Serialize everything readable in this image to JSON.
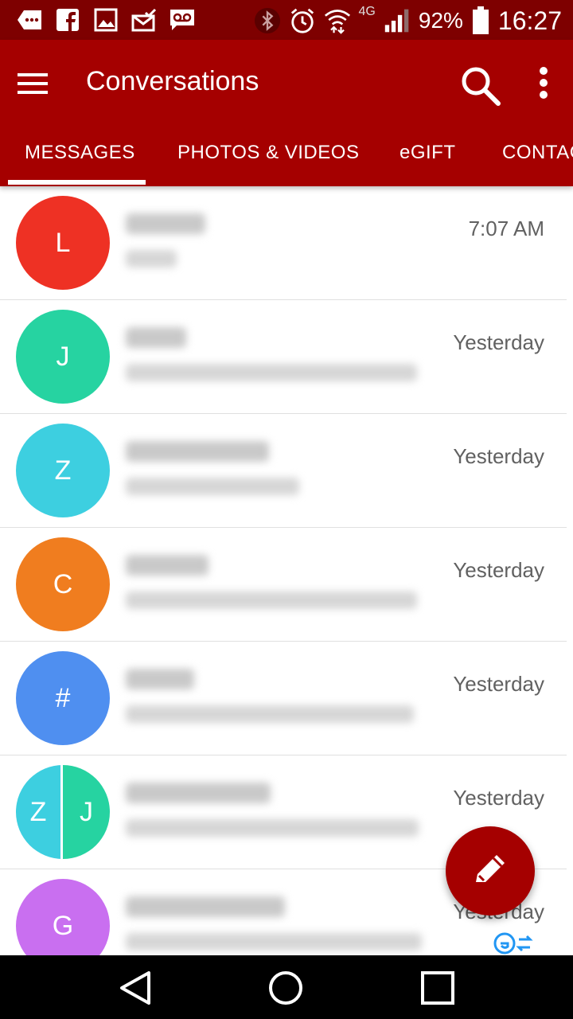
{
  "status_bar": {
    "battery": "92%",
    "network": "4G",
    "time": "16:27"
  },
  "app_bar": {
    "title": "Conversations"
  },
  "tabs": [
    {
      "label": "MESSAGES",
      "selected": true
    },
    {
      "label": "PHOTOS & VIDEOS",
      "selected": false
    },
    {
      "label": "eGIFT",
      "selected": false
    },
    {
      "label": "CONTACTS",
      "selected": false
    }
  ],
  "conversations": [
    {
      "avatar": "L",
      "avatar_color": "#ee3124",
      "time": "7:07 AM"
    },
    {
      "avatar": "J",
      "avatar_color": "#26d3a1",
      "time": "Yesterday"
    },
    {
      "avatar": "Z",
      "avatar_color": "#3dcfe0",
      "time": "Yesterday"
    },
    {
      "avatar": "C",
      "avatar_color": "#f07d1f",
      "time": "Yesterday"
    },
    {
      "avatar": "#",
      "avatar_color": "#4f8ff0",
      "time": "Yesterday"
    },
    {
      "avatar_left": "Z",
      "avatar_right": "J",
      "avatar_color_left": "#3dcfe0",
      "avatar_color_right": "#26d3a1",
      "time": "Yesterday"
    },
    {
      "avatar": "G",
      "avatar_color": "#c96ff0",
      "time": "Yesterday"
    }
  ],
  "colors": {
    "status_bar": "#7e0000",
    "app_bar": "#a50000",
    "fab": "#a50000"
  },
  "icons": {
    "menu": "hamburger-menu-icon",
    "search": "search-icon",
    "more": "more-vertical-icon",
    "compose": "pencil-icon",
    "nav_back": "back-triangle-icon",
    "nav_home": "home-circle-icon",
    "nav_recents": "recents-square-icon"
  }
}
